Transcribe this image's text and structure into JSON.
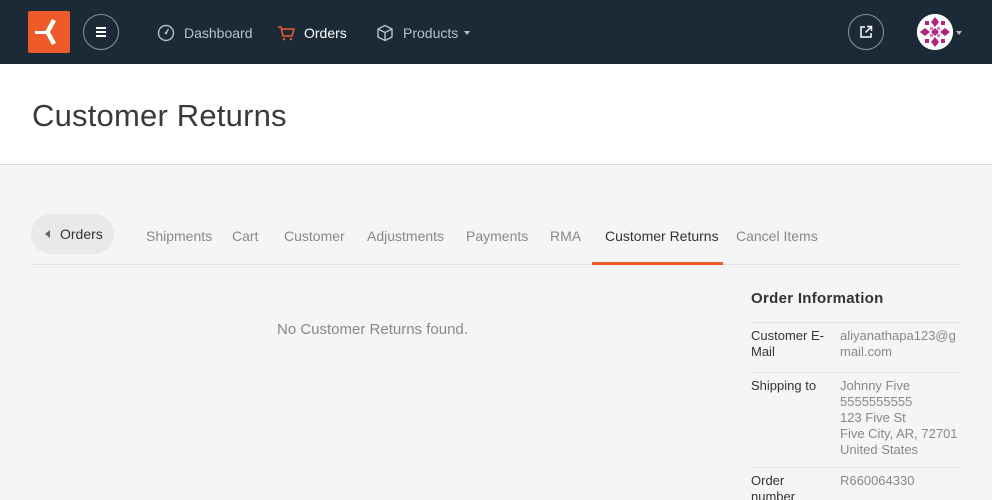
{
  "nav": {
    "items": [
      {
        "label": "Dashboard",
        "icon": "dashboard-icon"
      },
      {
        "label": "Orders",
        "icon": "cart-icon",
        "active": true
      },
      {
        "label": "Products",
        "icon": "box-icon",
        "has_dropdown": true
      }
    ]
  },
  "colors": {
    "topbar": "#1c2a38",
    "accent": "#ee5a2a"
  },
  "page": {
    "title": "Customer Returns"
  },
  "tabs": {
    "back_label": "Orders",
    "items": [
      "Shipments",
      "Cart",
      "Customer",
      "Adjustments",
      "Payments",
      "RMA",
      "Customer Returns",
      "Cancel Items"
    ],
    "active": "Customer Returns"
  },
  "empty_message": "No Customer Returns found.",
  "order_info": {
    "title": "Order Information",
    "email_label": "Customer E-Mail",
    "email": "aliyanathapa123@gmail.com",
    "shipping_label": "Shipping to",
    "shipping_lines": [
      "Johnny Five",
      "5555555555",
      "123 Five St",
      "Five City, AR, 72701",
      "United States"
    ],
    "order_number_label": "Order number",
    "order_number": "R660064330"
  }
}
